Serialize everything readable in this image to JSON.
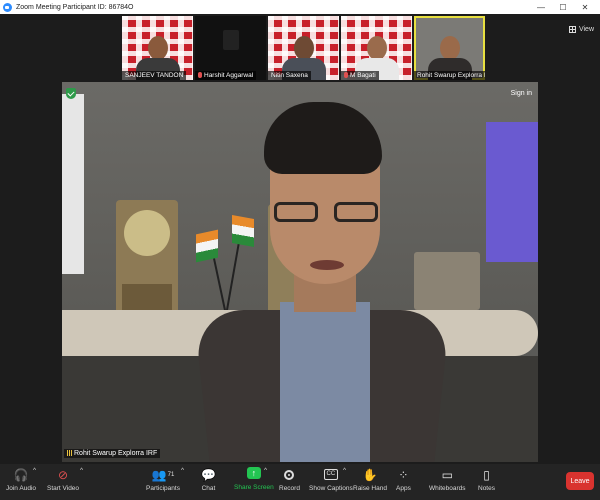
{
  "window": {
    "title": "Zoom Meeting Participant ID: 86784O",
    "controls": [
      "—",
      "☐",
      "✕"
    ]
  },
  "gallery": {
    "participants": [
      {
        "name": "SANJEEV TANDON",
        "muted": false
      },
      {
        "name": "Harshit Aggarwal",
        "muted": true
      },
      {
        "name": "Nitin Saxena",
        "muted": false
      },
      {
        "name": "M Bagati",
        "muted": true
      },
      {
        "name": "Rohit Swarup Explorra IRF",
        "muted": false
      }
    ],
    "view_label": "View"
  },
  "speaker": {
    "name": "Rohit Swarup Explorra IRF",
    "sign_in": "Sign in"
  },
  "toolbar": {
    "join_audio": "Join Audio",
    "start_video": "Start Video",
    "participants": "Participants",
    "participants_count": "71",
    "chat": "Chat",
    "share_screen": "Share Screen",
    "record": "Record",
    "show_captions": "Show Captions",
    "raise_hand": "Raise Hand",
    "apps": "Apps",
    "whiteboards": "Whiteboards",
    "notes": "Notes",
    "leave": "Leave"
  },
  "colors": {
    "share_green": "#23c552",
    "leave_red": "#d9332f",
    "active_speaker_border": "#e8e040"
  }
}
